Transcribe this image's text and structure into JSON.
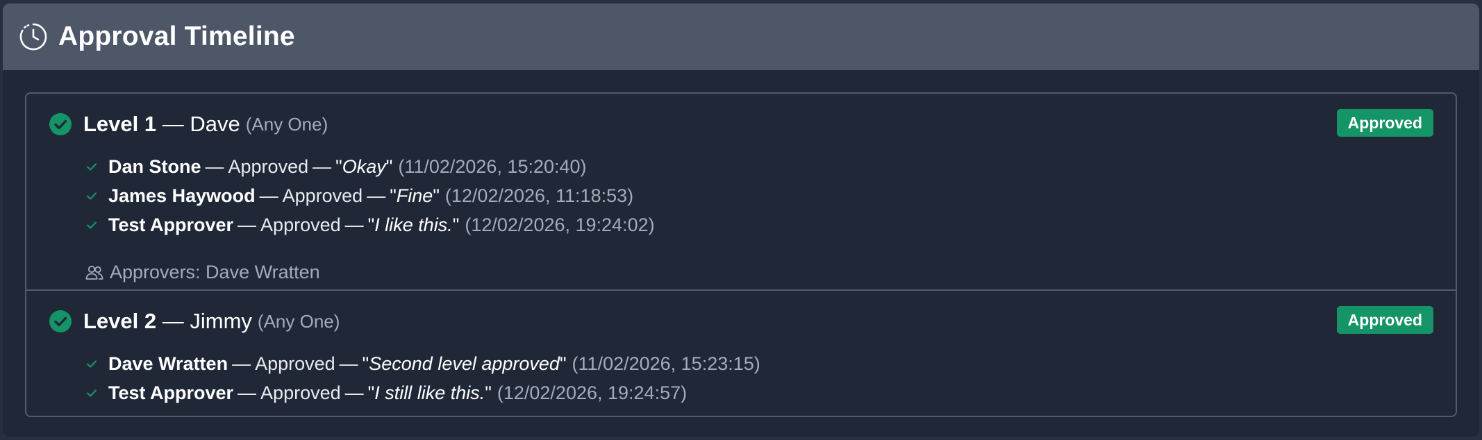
{
  "header": {
    "title": "Approval Timeline",
    "icon": "clock-icon"
  },
  "colors": {
    "header_bg": "#4d5768",
    "card_bg": "#202838",
    "approved_green": "#149467",
    "muted_text": "#a4acb8"
  },
  "levels": [
    {
      "name": "Level 1",
      "separator": "—",
      "owner": "Dave",
      "mode": "(Any One)",
      "status": "Approved",
      "entries": [
        {
          "approver": "Dan Stone",
          "action": "Approved",
          "comment": "Okay",
          "timestamp": "(11/02/2026, 15:20:40)"
        },
        {
          "approver": "James Haywood",
          "action": "Approved",
          "comment": "Fine",
          "timestamp": "(12/02/2026, 11:18:53)"
        },
        {
          "approver": "Test Approver",
          "action": "Approved",
          "comment": "I like this.",
          "timestamp": "(12/02/2026, 19:24:02)"
        }
      ],
      "approvers_text": "Approvers: Dave Wratten"
    },
    {
      "name": "Level 2",
      "separator": "—",
      "owner": "Jimmy",
      "mode": "(Any One)",
      "status": "Approved",
      "entries": [
        {
          "approver": "Dave Wratten",
          "action": "Approved",
          "comment": "Second level approved",
          "timestamp": "(11/02/2026, 15:23:15)"
        },
        {
          "approver": "Test Approver",
          "action": "Approved",
          "comment": "I still like this.",
          "timestamp": "(12/02/2026, 19:24:57)"
        }
      ]
    }
  ]
}
